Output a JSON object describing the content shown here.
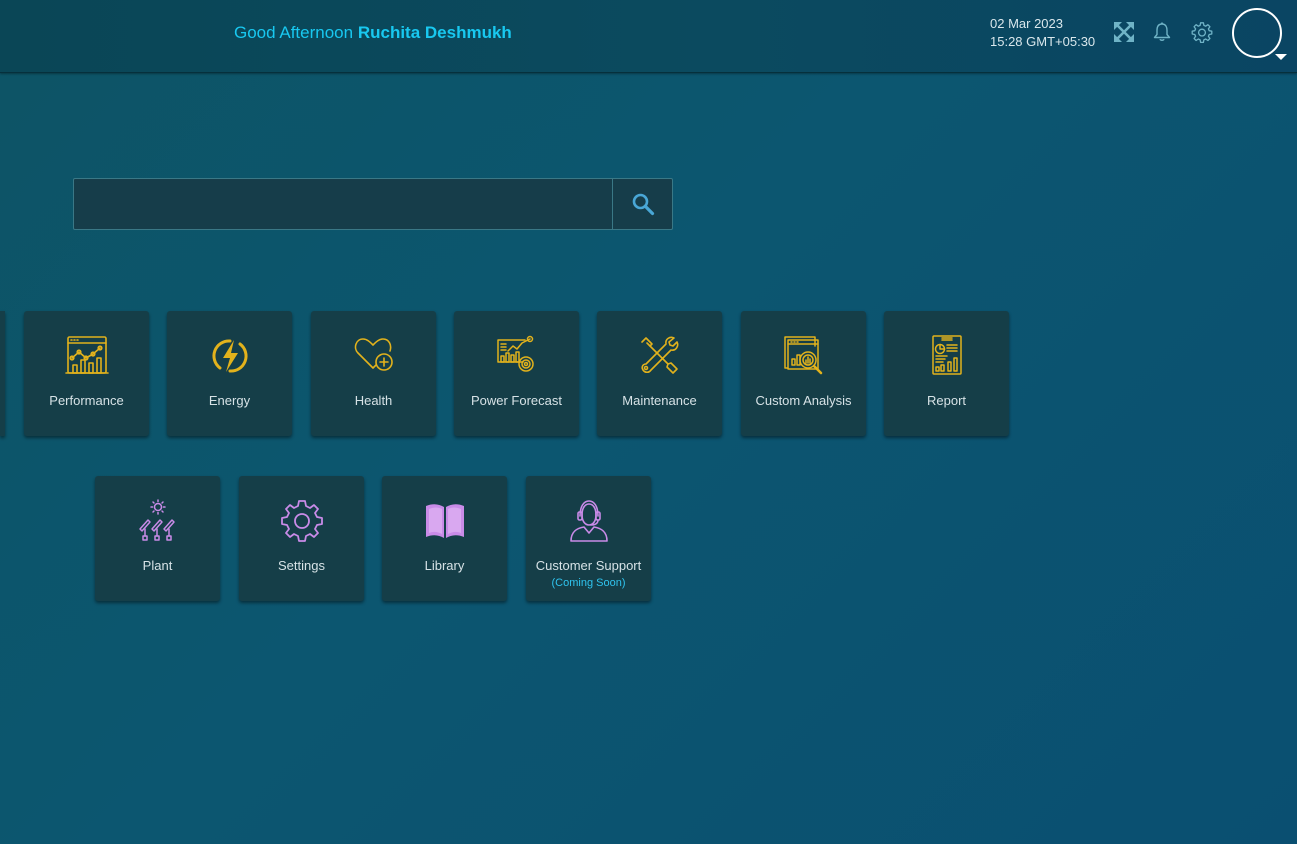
{
  "header": {
    "greeting_prefix": "Good Afternoon",
    "user_name": "Ruchita Deshmukh",
    "date": "02 Mar 2023",
    "time": "15:28 GMT+05:30",
    "icons": [
      "fullscreen-icon",
      "bell-icon",
      "gear-icon",
      "avatar",
      "caret-down-icon"
    ]
  },
  "search": {
    "value": "",
    "placeholder": "",
    "button_icon": "search-icon"
  },
  "modules_row1": [
    {
      "label": "Performance",
      "icon": "performance-icon"
    },
    {
      "label": "Energy",
      "icon": "energy-icon"
    },
    {
      "label": "Health",
      "icon": "health-icon"
    },
    {
      "label": "Power Forecast",
      "icon": "power-forecast-icon"
    },
    {
      "label": "Maintenance",
      "icon": "maintenance-icon"
    },
    {
      "label": "Custom Analysis",
      "icon": "custom-analysis-icon"
    },
    {
      "label": "Report",
      "icon": "report-icon"
    }
  ],
  "modules_row2": [
    {
      "label": "Plant",
      "icon": "plant-icon"
    },
    {
      "label": "Settings",
      "icon": "settings-icon"
    },
    {
      "label": "Library",
      "icon": "library-icon"
    },
    {
      "label": "Customer Support",
      "sublabel": "(Coming Soon)",
      "icon": "headset-icon"
    }
  ],
  "colors": {
    "accent": "#18c8f0",
    "icon_gold": "#e2b21c",
    "icon_violet": "#c98be8",
    "tile_bg": "#153e48"
  }
}
